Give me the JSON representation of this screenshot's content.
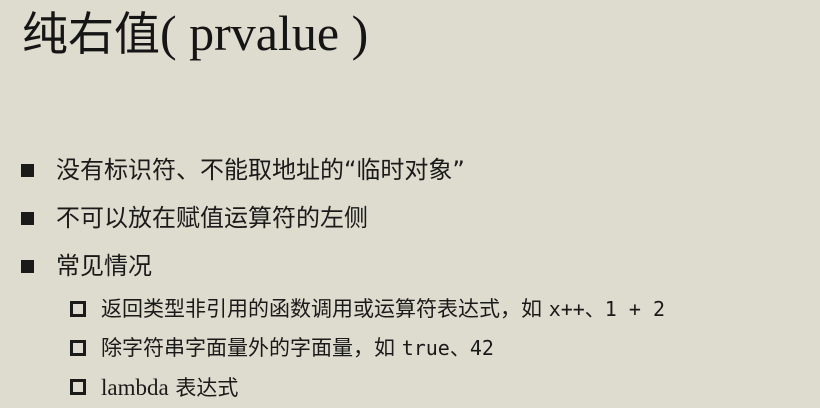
{
  "title": {
    "cjk": "纯右值",
    "latin": "( prvalue )"
  },
  "bullets": [
    {
      "text": "没有标识符、不能取地址的“临时对象”"
    },
    {
      "text": "不可以放在赋值运算符的左侧"
    },
    {
      "text": "常见情况"
    }
  ],
  "sub_bullets": [
    {
      "text": "返回类型非引用的函数调用或运算符表达式，如 ",
      "code": "x++、1 + 2"
    },
    {
      "text": "除字符串字面量外的字面量，如 ",
      "code": "true、42"
    },
    {
      "lead": "lambda",
      "text": " 表达式"
    }
  ]
}
